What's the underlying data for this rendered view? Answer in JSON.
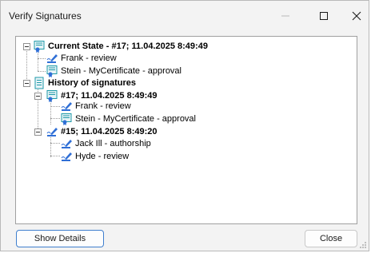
{
  "window": {
    "title": "Verify Signatures"
  },
  "tree": {
    "current_state": {
      "label": "Current State - #17;  11.04.2025  8:49:49",
      "children": [
        {
          "label": "Frank  - review",
          "icon": "pen-signature-icon"
        },
        {
          "label": "Stein  - MyCertificate - approval",
          "icon": "certificate-icon"
        }
      ]
    },
    "history": {
      "label": "History of signatures",
      "entries": [
        {
          "label": "#17;  11.04.2025  8:49:49",
          "icon": "certificate-icon",
          "children": [
            {
              "label": "Frank  - review",
              "icon": "pen-signature-icon"
            },
            {
              "label": "Stein  - MyCertificate - approval",
              "icon": "certificate-icon"
            }
          ]
        },
        {
          "label": "#15;  11.04.2025  8:49:20",
          "icon": "pen-signature-icon",
          "children": [
            {
              "label": "Jack Ill  - authorship",
              "icon": "pen-signature-icon"
            },
            {
              "label": "Hyde  - review",
              "icon": "pen-signature-icon"
            }
          ]
        }
      ]
    }
  },
  "buttons": {
    "show_details": "Show Details",
    "close": "Close"
  },
  "colors": {
    "focus_border": "#3f7fce",
    "icon_blue": "#2f6fd6",
    "icon_teal": "#1e9aa8"
  }
}
